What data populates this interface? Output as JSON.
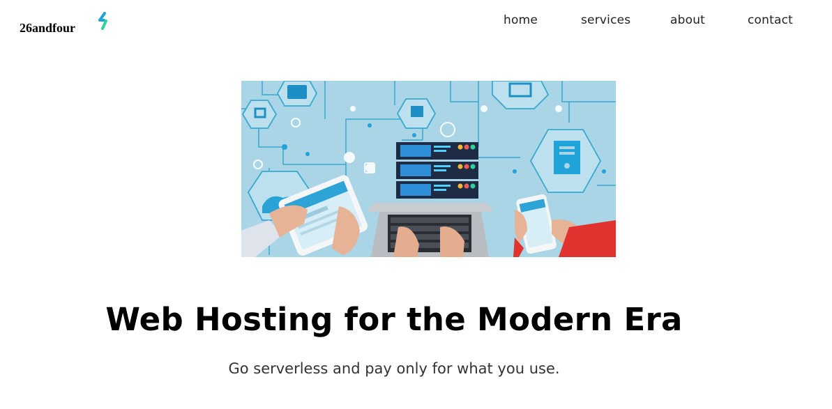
{
  "header": {
    "brand": "26andfour",
    "brand_icon": "lightning-bolt-icon",
    "nav": [
      {
        "label": "home"
      },
      {
        "label": "services"
      },
      {
        "label": "about"
      },
      {
        "label": "contact"
      }
    ]
  },
  "hero": {
    "image": "web-hosting-illustration",
    "headline": "Web Hosting for the Modern Era",
    "subtitle": "Go serverless and pay only for what you use."
  },
  "colors": {
    "accent_blue": "#1fa3d8",
    "accent_green": "#2fd39a",
    "hero_bg": "#a9d5e6",
    "server_navy": "#1e2b45"
  }
}
